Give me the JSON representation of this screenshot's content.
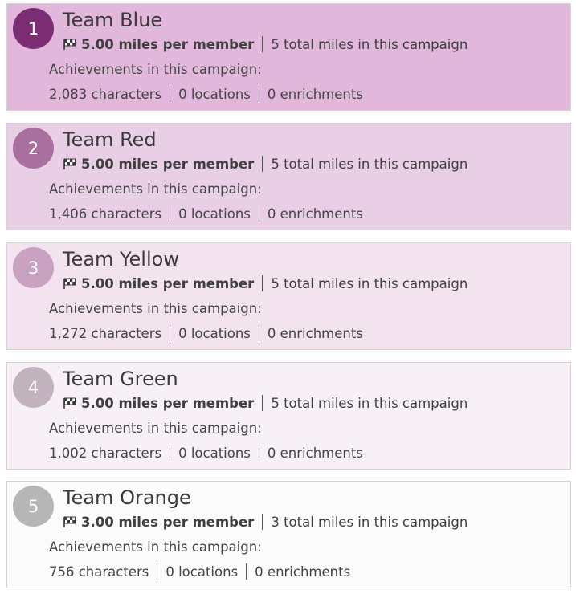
{
  "teams": [
    {
      "rank": "1",
      "name": "Team Blue",
      "per_member": "5.00 miles per member",
      "total": "5 total miles in this campaign",
      "achievements_label": "Achievements in this campaign:",
      "characters": "2,083 characters",
      "locations": "0 locations",
      "enrichments": "0 enrichments",
      "card_color": "#e1b7dc",
      "badge_color": "#7b2e74"
    },
    {
      "rank": "2",
      "name": "Team Red",
      "per_member": "5.00 miles per member",
      "total": "5 total miles in this campaign",
      "achievements_label": "Achievements in this campaign:",
      "characters": "1,406 characters",
      "locations": "0 locations",
      "enrichments": "0 enrichments",
      "card_color": "#e9cfe5",
      "badge_color": "#a9709f"
    },
    {
      "rank": "3",
      "name": "Team Yellow",
      "per_member": "5.00 miles per member",
      "total": "5 total miles in this campaign",
      "achievements_label": "Achievements in this campaign:",
      "characters": "1,272 characters",
      "locations": "0 locations",
      "enrichments": "0 enrichments",
      "card_color": "#f2e3ef",
      "badge_color": "#c9a2c1"
    },
    {
      "rank": "4",
      "name": "Team Green",
      "per_member": "5.00 miles per member",
      "total": "5 total miles in this campaign",
      "achievements_label": "Achievements in this campaign:",
      "characters": "1,002 characters",
      "locations": "0 locations",
      "enrichments": "0 enrichments",
      "card_color": "#f7f0f6",
      "badge_color": "#c2b3bf"
    },
    {
      "rank": "5",
      "name": "Team Orange",
      "per_member": "3.00 miles per member",
      "total": "3 total miles in this campaign",
      "achievements_label": "Achievements in this campaign:",
      "characters": "756 characters",
      "locations": "0 locations",
      "enrichments": "0 enrichments",
      "card_color": "#fbfbfb",
      "badge_color": "#b6b6b6"
    }
  ],
  "icons": {
    "flag": "checkered-flag-icon"
  }
}
